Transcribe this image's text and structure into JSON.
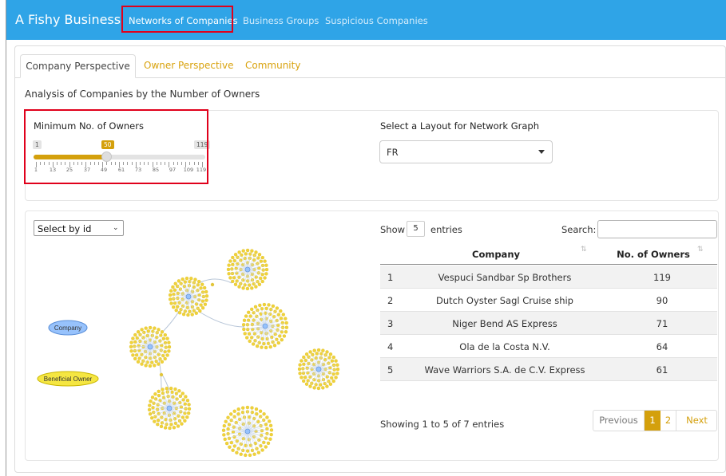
{
  "header": {
    "brand": "A Fishy Business",
    "nav": [
      "Networks of Companies",
      "Business Groups",
      "Suspicious Companies"
    ],
    "brand_color": "#2fa4e7"
  },
  "tabs": [
    "Company Perspective",
    "Owner Perspective",
    "Community"
  ],
  "heading": "Analysis of Companies by the Number of Owners",
  "slider": {
    "label": "Minimum No. of Owners",
    "min": 1,
    "max": 119,
    "value": 50,
    "ticks": [
      "1",
      "13",
      "25",
      "37",
      "49",
      "61",
      "73",
      "85",
      "97",
      "109",
      "119"
    ],
    "accent": "#d4a00c"
  },
  "layout": {
    "label": "Select a Layout for Network Graph",
    "selected": "FR"
  },
  "graph": {
    "select_label": "Select by id",
    "legend": [
      "Company",
      "Beneficial Owner"
    ],
    "company_color": "#97c2fc",
    "owner_color": "#f5e642"
  },
  "table": {
    "show_label": "Show",
    "entries_value": "5",
    "entries_label": "entries",
    "search_label": "Search:",
    "columns": [
      "Company",
      "No. of Owners"
    ],
    "rows": [
      {
        "idx": "1",
        "company": "Vespuci Sandbar Sp Brothers",
        "owners": "119"
      },
      {
        "idx": "2",
        "company": "Dutch Oyster Sagl Cruise ship",
        "owners": "90"
      },
      {
        "idx": "3",
        "company": "Niger Bend AS Express",
        "owners": "71"
      },
      {
        "idx": "4",
        "company": "Ola de la Costa N.V.",
        "owners": "64"
      },
      {
        "idx": "5",
        "company": "Wave Warriors S.A. de C.V. Express",
        "owners": "61"
      }
    ],
    "info": "Showing 1 to 5 of 7 entries",
    "pager": {
      "prev": "Previous",
      "pages": [
        "1",
        "2"
      ],
      "next": "Next"
    }
  }
}
